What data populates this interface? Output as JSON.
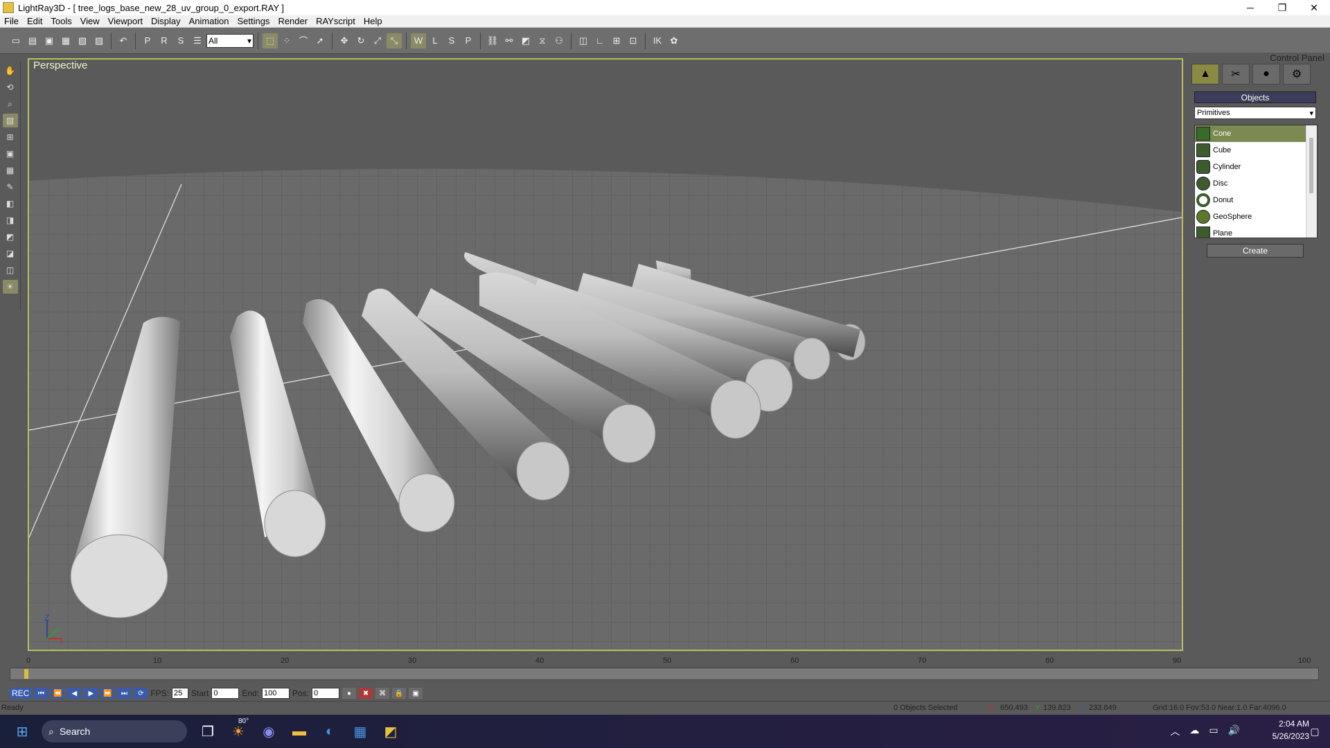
{
  "window": {
    "app_title": "LightRay3D - [ tree_logs_base_new_28_uv_group_0_export.RAY ]",
    "min": "─",
    "max": "❐",
    "close": "✕"
  },
  "menu": [
    "File",
    "Edit",
    "Tools",
    "View",
    "Viewport",
    "Display",
    "Animation",
    "Settings",
    "Render",
    "RAYscript",
    "Help"
  ],
  "toolbar": {
    "selection_filter": "All"
  },
  "viewport": {
    "label": "Perspective",
    "axis_z": "Z",
    "axis_y": "Y",
    "axis_x": "X"
  },
  "control_panel": {
    "title": "Control Panel",
    "section": "Objects",
    "category": "Primitives",
    "items": [
      {
        "label": "Cone"
      },
      {
        "label": "Cube"
      },
      {
        "label": "Cylinder"
      },
      {
        "label": "Disc"
      },
      {
        "label": "Donut"
      },
      {
        "label": "GeoSphere"
      },
      {
        "label": "Plane"
      }
    ],
    "create_button": "Create"
  },
  "timeline": {
    "ticks": [
      "0",
      "10",
      "20",
      "30",
      "40",
      "50",
      "60",
      "70",
      "80",
      "90",
      "100"
    ]
  },
  "animation_bar": {
    "rec": "REC",
    "fps_label": "FPS:",
    "fps_value": "25",
    "start_label": "Start",
    "start_value": "0",
    "end_label": "End:",
    "end_value": "100",
    "pos_label": "Pos:",
    "pos_value": "0"
  },
  "status": {
    "ready": "Ready",
    "selected": "0 Objects Selected",
    "x": "650.493",
    "y": "139.823",
    "z": "233.849",
    "grid": "Grid:16.0 Fov:53.0 Near:1.0 Far:4096.0"
  },
  "taskbar": {
    "search": "Search",
    "time": "2:04 AM",
    "date": "5/26/2023",
    "weather": "80°"
  }
}
